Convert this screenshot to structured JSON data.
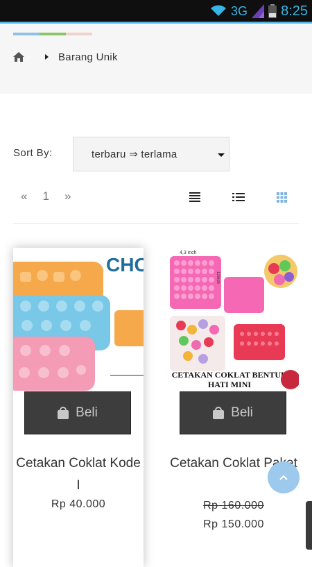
{
  "status_bar": {
    "network": "3G",
    "time": "8:25"
  },
  "header": {
    "stripe_colors": [
      "#8ec0e8",
      "#8cc46a",
      "#f1d2cb"
    ],
    "breadcrumb": {
      "home_icon": "home-icon",
      "current": "Barang Unik"
    }
  },
  "sort": {
    "label": "Sort By:",
    "selected": "terbaru ⇒ terlama"
  },
  "pagination": {
    "prev": "«",
    "page": "1",
    "next": "»"
  },
  "view_modes": [
    "align-justify-icon",
    "list-icon",
    "grid-icon"
  ],
  "products": [
    {
      "name": "Cetakan Coklat Kode I",
      "price": "Rp 40.000",
      "button": "Beli",
      "image_text": "CHOC"
    },
    {
      "name": "Cetakan Coklat Paket",
      "old_price": "Rp 160.000",
      "price": "Rp 150.000",
      "button": "Beli",
      "image_text": "CETAKAN COKLAT BENTUK HATI MINI",
      "image_dim": "4,3 inch",
      "image_dim2": "12inch"
    }
  ],
  "colors": {
    "accent": "#1ea0e8",
    "button": "#3d3d3d",
    "fab": "#9cc9ec",
    "active_view": "#7fb3e0"
  }
}
